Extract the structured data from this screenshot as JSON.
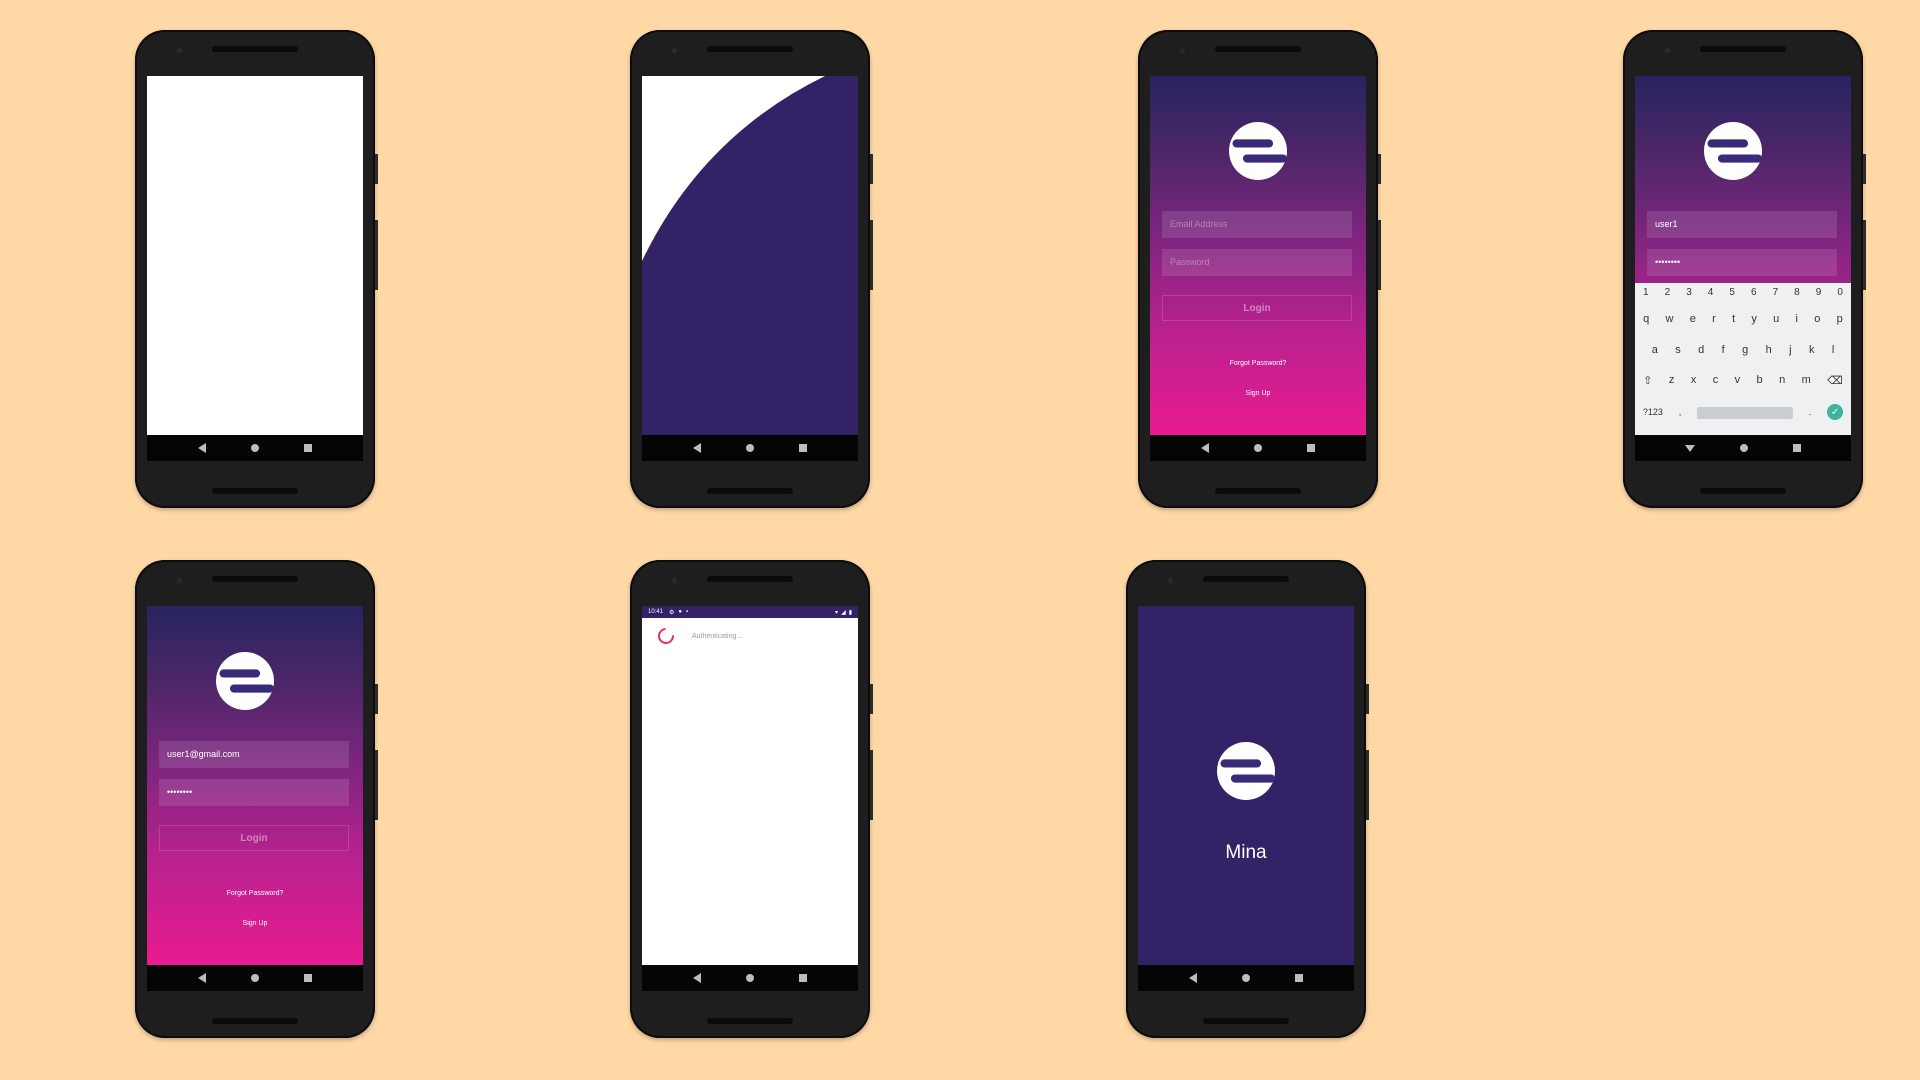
{
  "background_color": "#FFD8A6",
  "screens": {
    "blank": {},
    "splash_transition": {
      "curve_color": "#332266"
    },
    "login_empty": {
      "email_placeholder": "Email Address",
      "password_placeholder": "Password",
      "login_label": "Login",
      "forgot_label": "Forgot Password?",
      "signup_label": "Sign Up"
    },
    "login_keyboard": {
      "email_value": "user1",
      "password_value": "••••••••",
      "keyboard": {
        "row_numbers": [
          "1",
          "2",
          "3",
          "4",
          "5",
          "6",
          "7",
          "8",
          "9",
          "0"
        ],
        "row1": [
          "q",
          "w",
          "e",
          "r",
          "t",
          "y",
          "u",
          "i",
          "o",
          "p"
        ],
        "row2": [
          "a",
          "s",
          "d",
          "f",
          "g",
          "h",
          "j",
          "k",
          "l"
        ],
        "row3": [
          "z",
          "x",
          "c",
          "v",
          "b",
          "n",
          "m"
        ],
        "shift_icon": "shift-icon",
        "backspace_icon": "backspace-icon",
        "symbols_label": "?123",
        "comma_label": ",",
        "period_label": ".",
        "done_icon": "check-icon"
      }
    },
    "login_filled": {
      "email_value": "user1@gmail.com",
      "password_value": "••••••••",
      "login_label": "Login",
      "forgot_label": "Forgot Password?",
      "signup_label": "Sign Up"
    },
    "authenticating": {
      "status_time": "10:41",
      "message": "Authenticating..."
    },
    "splash": {
      "app_name": "Mina",
      "background": "#332266"
    }
  }
}
